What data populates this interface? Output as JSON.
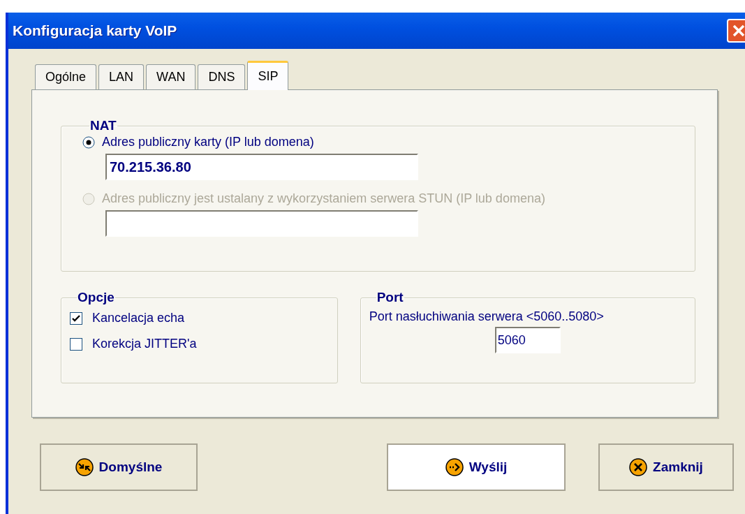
{
  "window": {
    "title": "Konfiguracja karty VoIP"
  },
  "tabs": [
    {
      "label": "Ogólne",
      "selected": false
    },
    {
      "label": "LAN",
      "selected": false
    },
    {
      "label": "WAN",
      "selected": false
    },
    {
      "label": "DNS",
      "selected": false
    },
    {
      "label": "SIP",
      "selected": true
    }
  ],
  "nat": {
    "title": "NAT",
    "options": [
      {
        "label": "Adres publiczny karty (IP lub domena)",
        "selected": true,
        "disabled": false,
        "value": "70.215.36.80"
      },
      {
        "label": "Adres publiczny jest ustalany z wykorzystaniem serwera STUN (IP lub domena)",
        "selected": false,
        "disabled": true
      }
    ]
  },
  "options": {
    "title": "Opcje",
    "items": [
      {
        "label": "Kancelacja echa",
        "checked": true
      },
      {
        "label": "Korekcja JITTER'a",
        "checked": false
      }
    ]
  },
  "port": {
    "title": "Port",
    "label": "Port nasłuchiwania serwera <5060..5080>",
    "value": "5060"
  },
  "buttons": [
    {
      "label": "Domyślne",
      "kind": "defaults",
      "default": false
    },
    {
      "label": "Wyślij",
      "kind": "send",
      "default": true
    },
    {
      "label": "Zamknij",
      "kind": "close",
      "default": false
    }
  ]
}
